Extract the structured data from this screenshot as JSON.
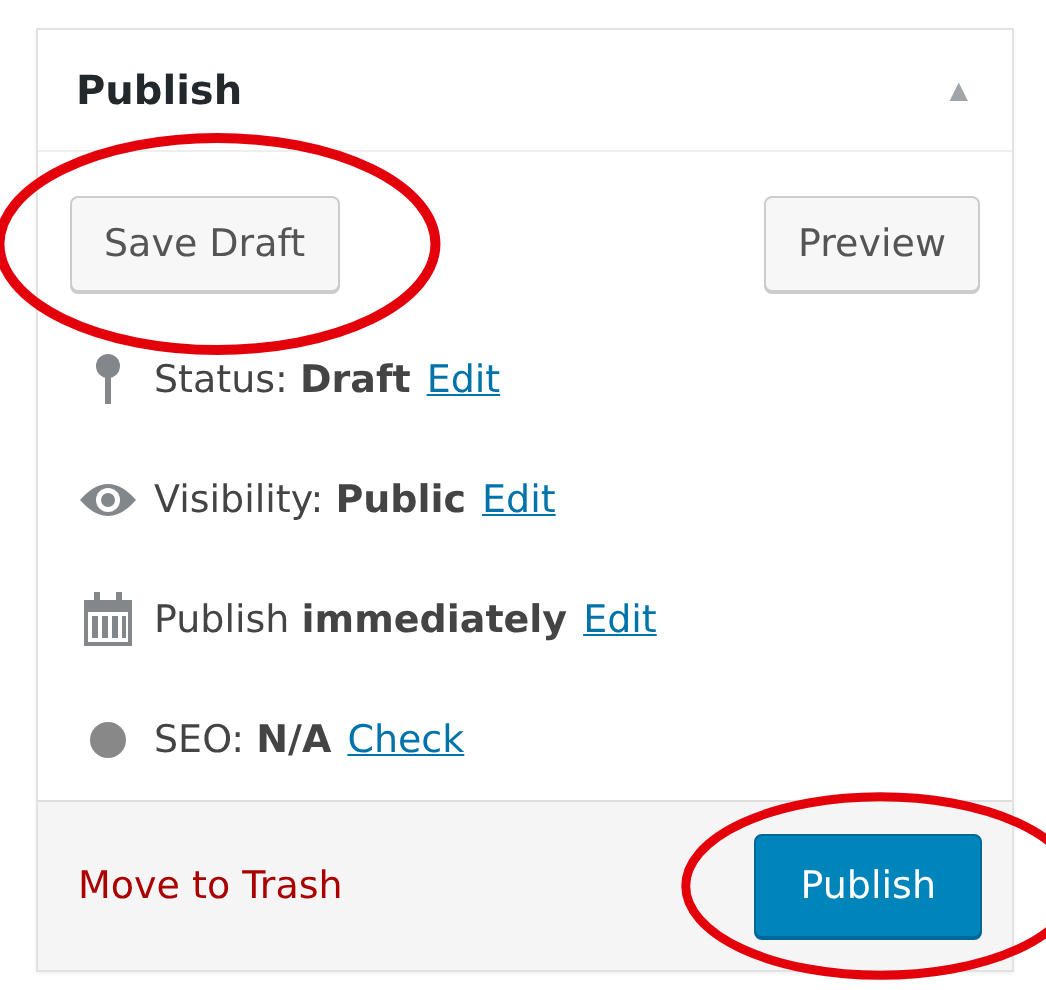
{
  "box": {
    "title": "Publish",
    "collapse_icon": "▲"
  },
  "actions": [
    {
      "label": "Save Draft",
      "kind": "secondary",
      "circled": true
    },
    {
      "label": "Preview",
      "kind": "secondary"
    }
  ],
  "rows": [
    {
      "kind": "pin",
      "text": "Status: **Draft**",
      "link": "Edit"
    },
    {
      "kind": "eye",
      "text": "Visibility: **Public**",
      "link": "Edit"
    },
    {
      "kind": "calendar",
      "text": "Publish **immediately**",
      "link": "Edit"
    },
    {
      "kind": "dot",
      "text": "SEO: **N/A**",
      "link": "Check"
    }
  ],
  "footer": {
    "trash_link": "Move to Trash",
    "publish_button": {
      "label": "Publish",
      "kind": "primary",
      "circled": true
    }
  }
}
